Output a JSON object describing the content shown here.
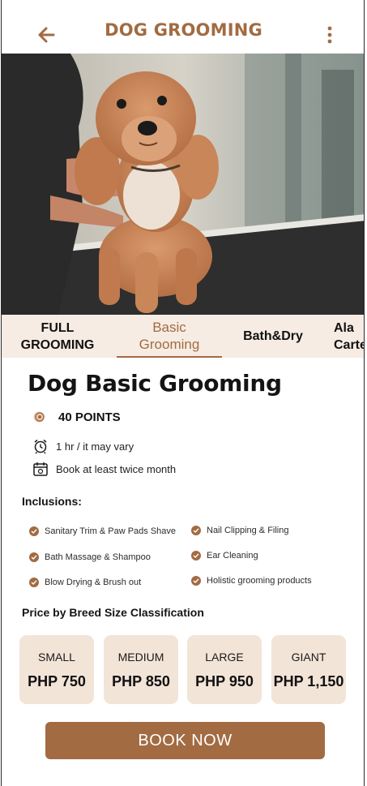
{
  "header": {
    "title": "DOG GROOMING",
    "back_icon": "arrow-left-icon",
    "menu_icon": "more-vertical-icon"
  },
  "hero": {
    "subject": "photo"
  },
  "tabs": [
    {
      "label_line1": "FULL",
      "label_line2": "GROOMING",
      "active": false
    },
    {
      "label_line1": "Basic",
      "label_line2": "Grooming",
      "active": true
    },
    {
      "label_line1": "Bath&Dry",
      "label_line2": "",
      "active": false
    },
    {
      "label_line1": "Ala",
      "label_line2": "Carte",
      "active": false
    }
  ],
  "service": {
    "title": "Dog Basic Grooming",
    "points": "40 POINTS",
    "duration": "1 hr / it may vary",
    "frequency": "Book at least twice  month"
  },
  "inclusions": {
    "heading": "Inclusions:",
    "left": [
      "Sanitary Trim & Paw Pads Shave",
      "Bath Massage & Shampoo",
      "Blow Drying & Brush out"
    ],
    "right": [
      "Nail Clipping & Filing",
      "Ear Cleaning",
      "Holistic grooming products"
    ]
  },
  "pricing": {
    "heading": "Price by Breed Size Classification",
    "cards": [
      {
        "size": "SMALL",
        "price": "PHP 750"
      },
      {
        "size": "MEDIUM",
        "price": "PHP 850"
      },
      {
        "size": "LARGE",
        "price": "PHP 950"
      },
      {
        "size": "GIANT",
        "price": "PHP 1,150"
      }
    ]
  },
  "cta": {
    "label": "BOOK NOW"
  },
  "colors": {
    "accent": "#a26b42",
    "tab_bg": "#f6ece3",
    "card_bg": "#f2e4d7"
  }
}
